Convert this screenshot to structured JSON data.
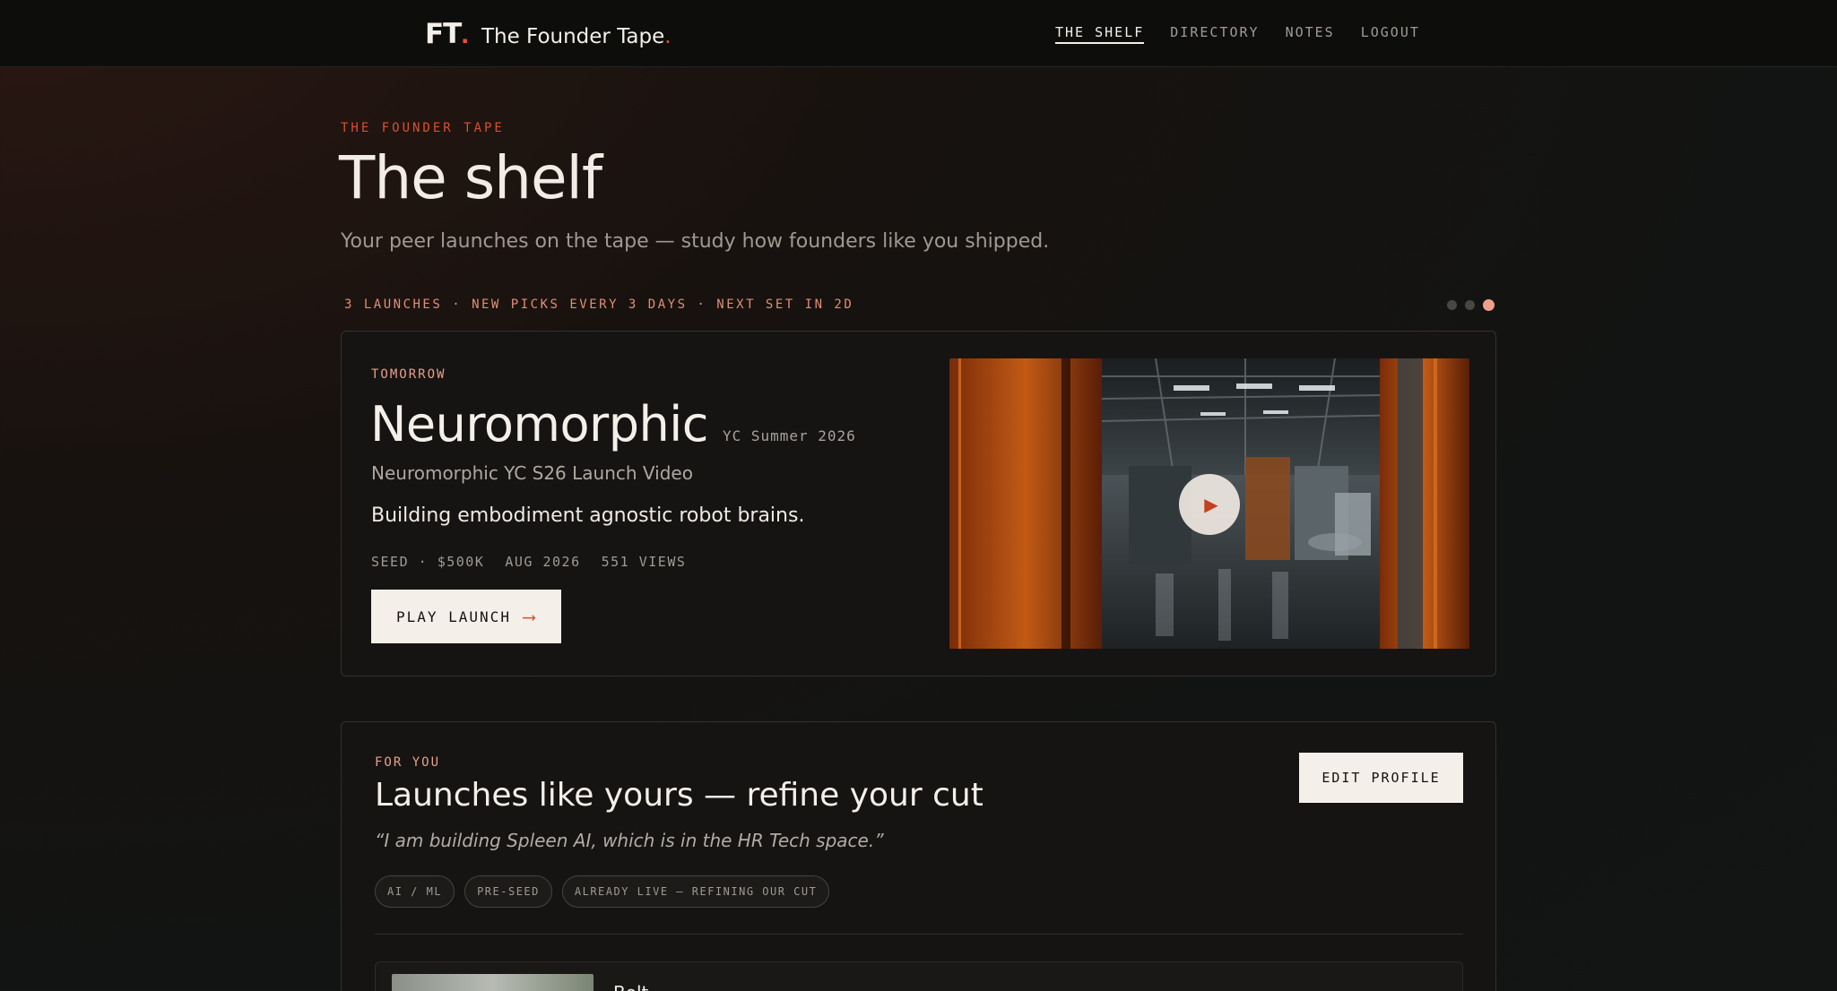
{
  "nav": {
    "logo_mark": "FT",
    "logo_dot": ".",
    "site_name": "The Founder Tape",
    "site_name_dot": ".",
    "links": [
      "THE SHELF",
      "DIRECTORY",
      "NOTES",
      "LOGOUT"
    ],
    "active_link": "THE SHELF"
  },
  "header": {
    "eyebrow": "THE FOUNDER TAPE",
    "title": "The shelf",
    "subtitle": "Your peer launches on the tape — study how founders like you shipped.",
    "meta": "3 LAUNCHES · NEW PICKS EVERY 3 DAYS · NEXT SET IN 2D",
    "carousel_dots": 3,
    "carousel_active_index": 2
  },
  "feature": {
    "eyebrow": "TOMORROW",
    "title": "Neuromorphic",
    "batch": "YC Summer 2026",
    "video_title": "Neuromorphic YC S26 Launch Video",
    "tagline": "Building embodiment agnostic robot brains.",
    "stats": [
      "SEED · $500K",
      "AUG 2026",
      "551 VIEWS"
    ],
    "play_label": "PLAY LAUNCH",
    "play_arrow": "⟶",
    "video_play_glyph": "▶"
  },
  "for_you": {
    "eyebrow": "FOR YOU",
    "title": "Launches like yours — refine your cut",
    "quote": "“I am building Spleen AI, which is in the HR Tech space.”",
    "chips": [
      "AI / ML",
      "PRE-SEED",
      "ALREADY LIVE — REFINING OUR CUT"
    ],
    "edit_label": "EDIT PROFILE",
    "first_item_name": "Bolt"
  },
  "colors": {
    "accent": "#d9502b",
    "accent_soft": "#e4a08a",
    "background": "#121413",
    "card": "#161514",
    "text": "#f4efe8"
  }
}
